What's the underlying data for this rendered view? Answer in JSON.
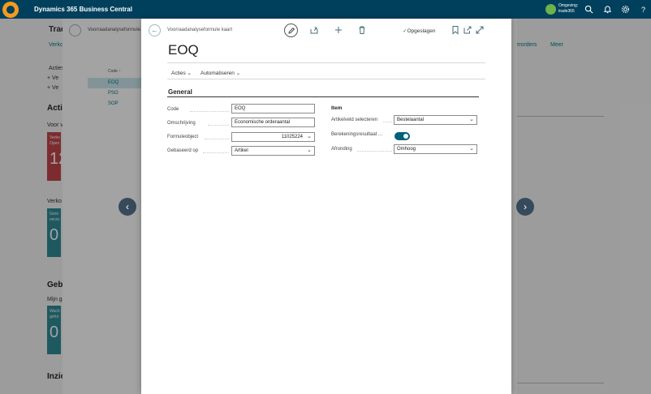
{
  "topbar": {
    "app_title": "Dynamics 365 Business Central",
    "environment_label": "Omgeving:",
    "environment_name": "trade365"
  },
  "background": {
    "title": "Trad",
    "link_verko": "Verko",
    "link_transfer": "nsferorders",
    "link_meer": "Meer",
    "acties": "Acties",
    "add1": "+ Ve",
    "add2": "+ Ve",
    "section_activ": "Activ",
    "voor": "Voor v",
    "tile1_text1": "Verko",
    "tile1_text2": "Open",
    "tile1_value": "12",
    "verko_label": "Verko",
    "tile2_text1": "Gere",
    "tile2_text2": "verzo",
    "tile2_value": "0",
    "section_gebr": "Gebr",
    "mijn": "Mijn g",
    "tile3_text1": "Wach",
    "tile3_text2": "gefor",
    "tile3_value": "0",
    "section_inzic": "Inzic"
  },
  "list_page": {
    "title": "Voorraadanalyseformule",
    "column_header": "Code ↑",
    "rows": [
      {
        "code": "EOQ"
      },
      {
        "code": "PSO"
      },
      {
        "code": "SOP"
      }
    ]
  },
  "card": {
    "breadcrumb": "Voorraadanalyseformule kaart",
    "saved_label": "Opgeslagen",
    "heading": "EOQ",
    "actions": {
      "acties": "Acties",
      "automatiseren": "Automatiseren"
    },
    "section_title": "General",
    "left_fields": [
      {
        "label": "Code",
        "value": "EOQ",
        "type": "text"
      },
      {
        "label": "Omschrijving",
        "value": "Economische orderaantal",
        "type": "text"
      },
      {
        "label": "Formuleobject",
        "value": "11025224",
        "type": "lookup"
      },
      {
        "label": "Gebaseerd op",
        "value": "Artikel",
        "type": "select"
      }
    ],
    "item_heading": "Item",
    "right_fields": [
      {
        "label": "Artikelveld selecteren",
        "value": "Bestelaantal",
        "type": "select"
      },
      {
        "label": "Berekeningsresultaat ...",
        "value": "on",
        "type": "toggle"
      },
      {
        "label": "Afronding",
        "value": "Omhoog",
        "type": "select"
      }
    ]
  },
  "colors": {
    "topbar": "#00405c",
    "accent": "#00798a",
    "toggle_on": "#00607a",
    "tile_red": "#c2454a",
    "tile_teal": "#2f8b96"
  }
}
